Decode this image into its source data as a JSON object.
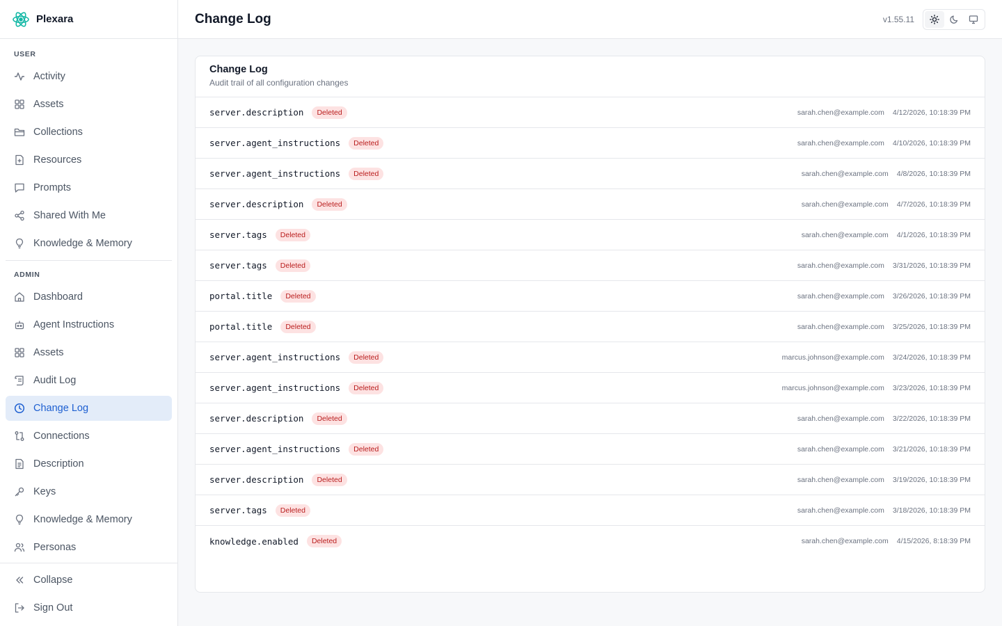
{
  "brand": {
    "name": "Plexara"
  },
  "sidebar": {
    "user_label": "USER",
    "user_items": [
      {
        "label": "Activity",
        "icon": "activity-icon"
      },
      {
        "label": "Assets",
        "icon": "grid-icon"
      },
      {
        "label": "Collections",
        "icon": "folder-icon"
      },
      {
        "label": "Resources",
        "icon": "file-icon"
      },
      {
        "label": "Prompts",
        "icon": "message-icon"
      },
      {
        "label": "Shared With Me",
        "icon": "share-icon"
      },
      {
        "label": "Knowledge & Memory",
        "icon": "lightbulb-icon"
      }
    ],
    "admin_label": "ADMIN",
    "admin_items": [
      {
        "label": "Dashboard",
        "icon": "home-icon"
      },
      {
        "label": "Agent Instructions",
        "icon": "bot-icon"
      },
      {
        "label": "Assets",
        "icon": "grid-icon"
      },
      {
        "label": "Audit Log",
        "icon": "scroll-icon"
      },
      {
        "label": "Change Log",
        "icon": "clock-icon",
        "active": true
      },
      {
        "label": "Connections",
        "icon": "connections-icon"
      },
      {
        "label": "Description",
        "icon": "document-icon"
      },
      {
        "label": "Keys",
        "icon": "key-icon"
      },
      {
        "label": "Knowledge & Memory",
        "icon": "lightbulb-icon"
      },
      {
        "label": "Personas",
        "icon": "users-icon"
      }
    ],
    "collapse_label": "Collapse",
    "signout_label": "Sign Out"
  },
  "header": {
    "title": "Change Log",
    "version": "v1.55.11"
  },
  "card": {
    "title": "Change Log",
    "subtitle": "Audit trail of all configuration changes"
  },
  "rows": [
    {
      "key": "server.description",
      "status": "Deleted",
      "user": "sarah.chen@example.com",
      "time": "4/12/2026, 10:18:39 PM"
    },
    {
      "key": "server.agent_instructions",
      "status": "Deleted",
      "user": "sarah.chen@example.com",
      "time": "4/10/2026, 10:18:39 PM"
    },
    {
      "key": "server.agent_instructions",
      "status": "Deleted",
      "user": "sarah.chen@example.com",
      "time": "4/8/2026, 10:18:39 PM"
    },
    {
      "key": "server.description",
      "status": "Deleted",
      "user": "sarah.chen@example.com",
      "time": "4/7/2026, 10:18:39 PM"
    },
    {
      "key": "server.tags",
      "status": "Deleted",
      "user": "sarah.chen@example.com",
      "time": "4/1/2026, 10:18:39 PM"
    },
    {
      "key": "server.tags",
      "status": "Deleted",
      "user": "sarah.chen@example.com",
      "time": "3/31/2026, 10:18:39 PM"
    },
    {
      "key": "portal.title",
      "status": "Deleted",
      "user": "sarah.chen@example.com",
      "time": "3/26/2026, 10:18:39 PM"
    },
    {
      "key": "portal.title",
      "status": "Deleted",
      "user": "sarah.chen@example.com",
      "time": "3/25/2026, 10:18:39 PM"
    },
    {
      "key": "server.agent_instructions",
      "status": "Deleted",
      "user": "marcus.johnson@example.com",
      "time": "3/24/2026, 10:18:39 PM"
    },
    {
      "key": "server.agent_instructions",
      "status": "Deleted",
      "user": "marcus.johnson@example.com",
      "time": "3/23/2026, 10:18:39 PM"
    },
    {
      "key": "server.description",
      "status": "Deleted",
      "user": "sarah.chen@example.com",
      "time": "3/22/2026, 10:18:39 PM"
    },
    {
      "key": "server.agent_instructions",
      "status": "Deleted",
      "user": "sarah.chen@example.com",
      "time": "3/21/2026, 10:18:39 PM"
    },
    {
      "key": "server.description",
      "status": "Deleted",
      "user": "sarah.chen@example.com",
      "time": "3/19/2026, 10:18:39 PM"
    },
    {
      "key": "server.tags",
      "status": "Deleted",
      "user": "sarah.chen@example.com",
      "time": "3/18/2026, 10:18:39 PM"
    },
    {
      "key": "knowledge.enabled",
      "status": "Deleted",
      "user": "sarah.chen@example.com",
      "time": "4/15/2026, 8:18:39 PM"
    }
  ],
  "colors": {
    "accent": "#1d5fd1",
    "active_bg": "#e3ecf9",
    "badge_bg": "#fde2e2",
    "badge_text": "#b91c1c",
    "logo": "#14b8a6"
  }
}
